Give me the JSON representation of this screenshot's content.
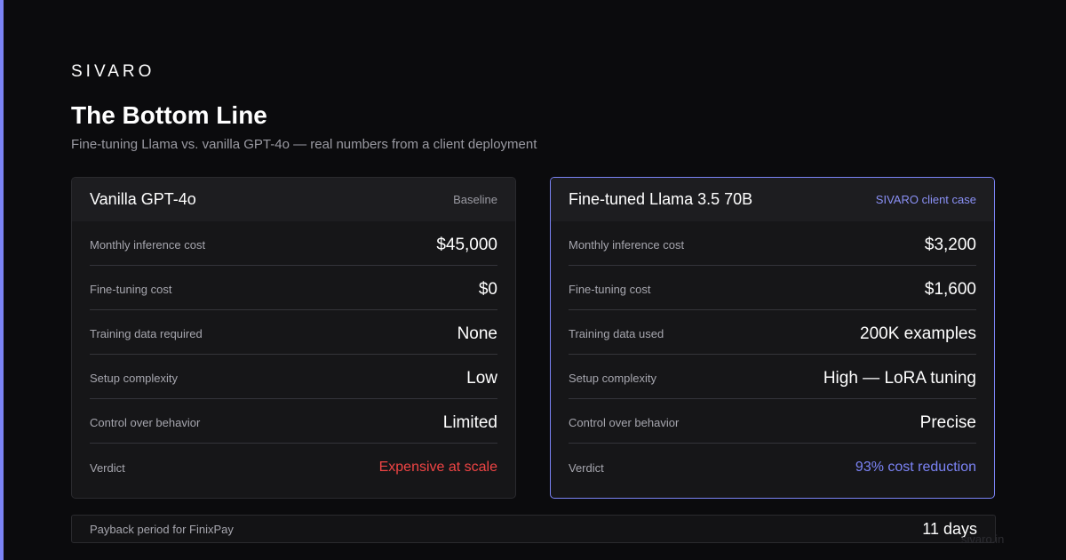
{
  "brand": "SIVARO",
  "header": {
    "title": "The Bottom Line",
    "subtitle": "Fine-tuning Llama vs. vanilla GPT-4o — real numbers from a client deployment"
  },
  "cards": [
    {
      "name": "Vanilla GPT-4o",
      "tag": "Baseline",
      "rows": [
        {
          "label": "Monthly inference cost",
          "value": "$45,000"
        },
        {
          "label": "Fine-tuning cost",
          "value": "$0"
        },
        {
          "label": "Training data required",
          "value": "None"
        },
        {
          "label": "Setup complexity",
          "value": "Low"
        },
        {
          "label": "Control over behavior",
          "value": "Limited"
        },
        {
          "label": "Verdict",
          "value": "Expensive at scale"
        }
      ]
    },
    {
      "name": "Fine-tuned Llama 3.5 70B",
      "tag": "SIVARO client case",
      "rows": [
        {
          "label": "Monthly inference cost",
          "value": "$3,200"
        },
        {
          "label": "Fine-tuning cost",
          "value": "$1,600"
        },
        {
          "label": "Training data used",
          "value": "200K examples"
        },
        {
          "label": "Setup complexity",
          "value": "High — LoRA tuning"
        },
        {
          "label": "Control over behavior",
          "value": "Precise"
        },
        {
          "label": "Verdict",
          "value": "93% cost reduction"
        }
      ]
    }
  ],
  "footer": {
    "label": "Payback period for FinixPay",
    "value": "11 days"
  },
  "watermark": "sivaro.in",
  "colors": {
    "accent": "#7b83f5",
    "negative": "#ef4444",
    "background": "#0b0b0d"
  }
}
